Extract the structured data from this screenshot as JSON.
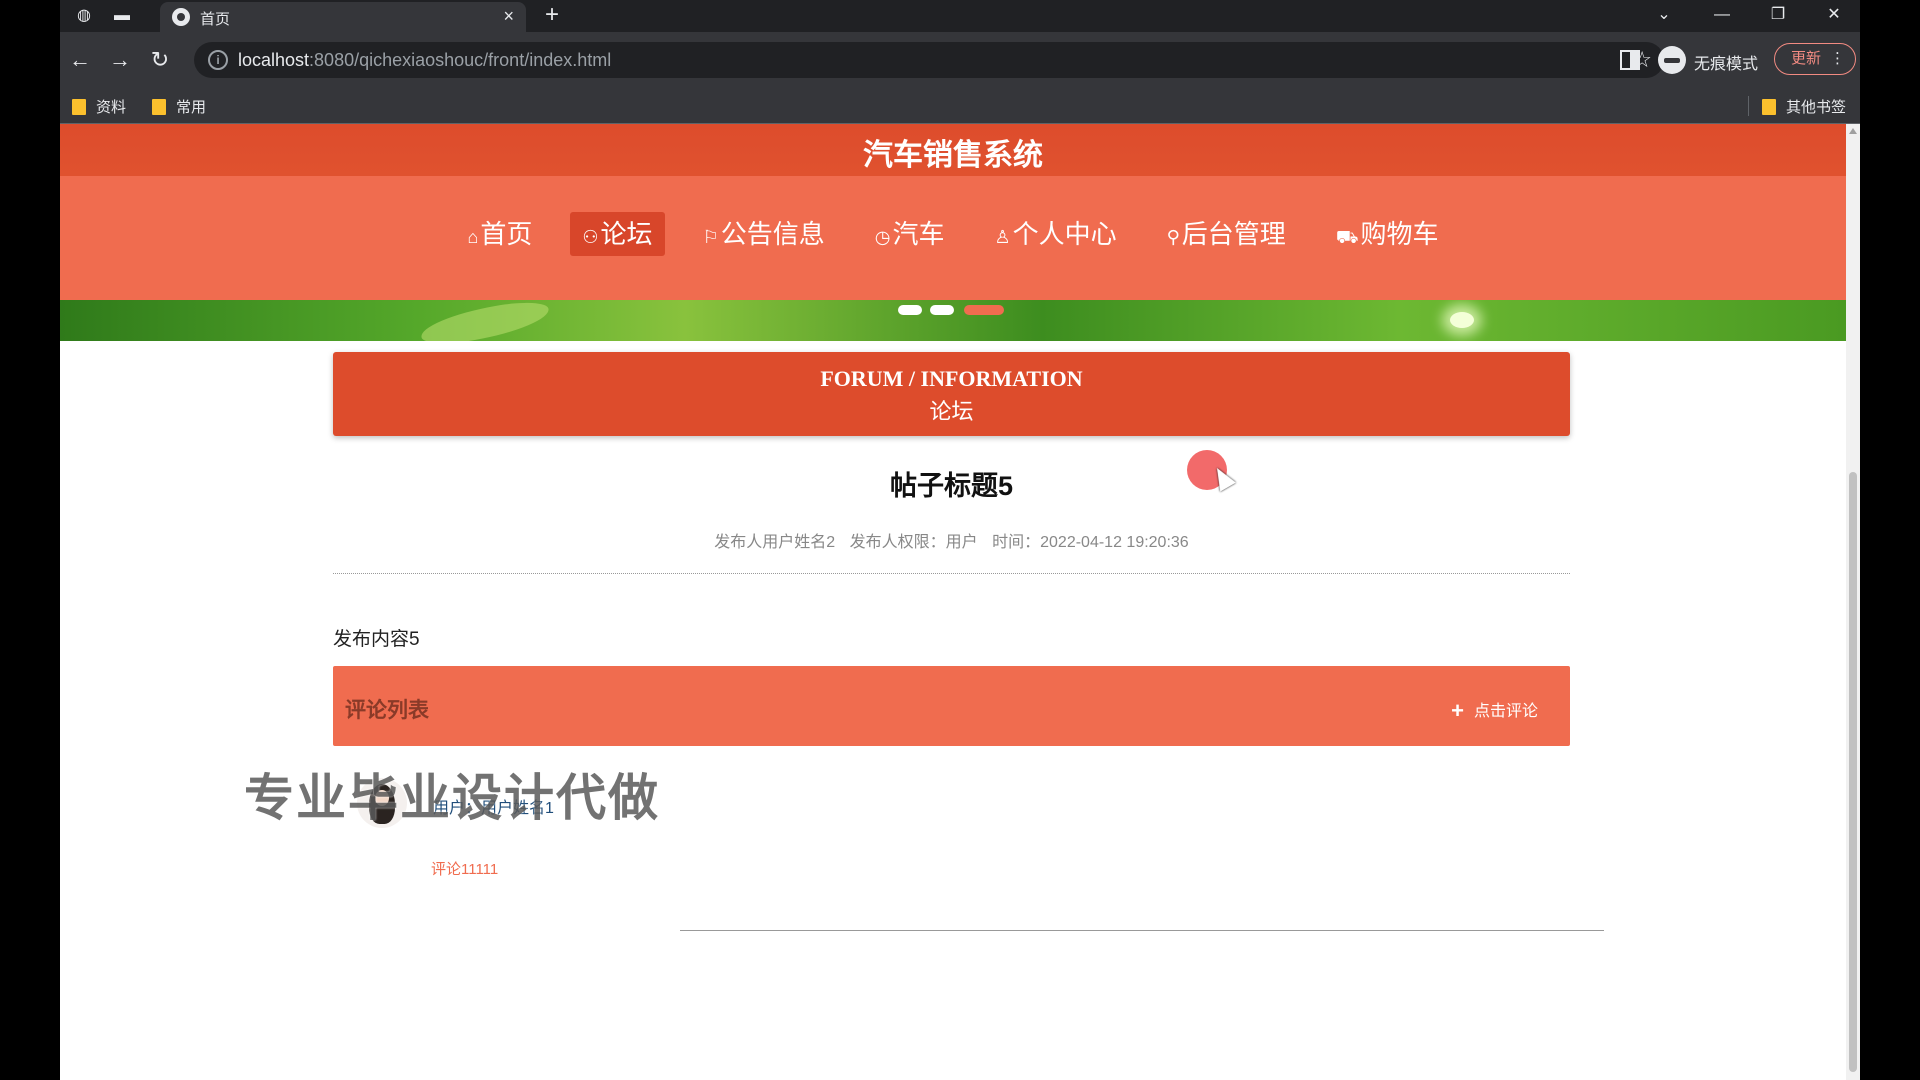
{
  "browser": {
    "tab_title": "首页",
    "tab_close": "×",
    "new_tab": "+",
    "url_host": "localhost",
    "url_rest": ":8080/qichexiaoshouc/front/index.html",
    "incognito_label": "无痕模式",
    "update_label": "更新",
    "bookmarks": [
      "资料",
      "常用"
    ],
    "other_bookmarks": "其他书签"
  },
  "site": {
    "title": "汽车销售系统",
    "nav": [
      {
        "icon": "⌂",
        "label": "首页"
      },
      {
        "icon": "⚇",
        "label": "论坛"
      },
      {
        "icon": "⚐",
        "label": "公告信息"
      },
      {
        "icon": "◷",
        "label": "汽车"
      },
      {
        "icon": "♙",
        "label": "个人中心"
      },
      {
        "icon": "⚲",
        "label": "后台管理"
      },
      {
        "icon": "⛟",
        "label": "购物车"
      }
    ],
    "active_nav_index": 1,
    "carousel_active_index": 2,
    "accent_color": "#f06c4f",
    "header_color": "#dd4c2c"
  },
  "forum": {
    "section_en": "FORUM / INFORMATION",
    "section_cn": "论坛",
    "post_title": "帖子标题5",
    "meta_publisher": "发布人用户姓名2",
    "meta_role": "发布人权限：用户",
    "meta_time": "时间：2022-04-12 19:20:36",
    "content": "发布内容5",
    "comments_title": "评论列表",
    "add_comment": "点击评论",
    "comments": [
      {
        "user": "用户：用户姓名1",
        "text": "评论11111"
      }
    ]
  },
  "watermark": "专业毕业设计代做"
}
